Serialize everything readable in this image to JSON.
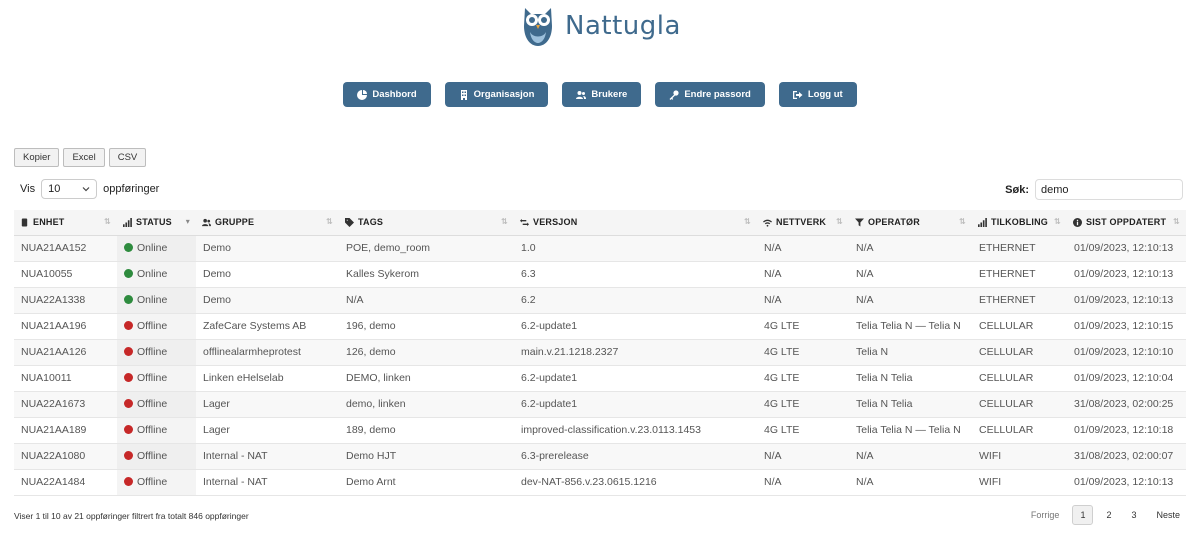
{
  "brand": {
    "name": "Nattugla"
  },
  "nav": [
    {
      "label": "Dashbord",
      "icon": "pie-chart-icon"
    },
    {
      "label": "Organisasjon",
      "icon": "building-icon"
    },
    {
      "label": "Brukere",
      "icon": "users-icon"
    },
    {
      "label": "Endre passord",
      "icon": "key-icon"
    },
    {
      "label": "Logg ut",
      "icon": "logout-icon"
    }
  ],
  "export": {
    "copy": "Kopier",
    "excel": "Excel",
    "csv": "CSV"
  },
  "length": {
    "prefix": "Vis",
    "value": "10",
    "suffix": "oppføringer"
  },
  "search": {
    "label": "Søk:",
    "value": "demo"
  },
  "columns": [
    {
      "label": "ENHET",
      "icon": "device-icon"
    },
    {
      "label": "STATUS",
      "icon": "signal-bars-icon"
    },
    {
      "label": "GRUPPE",
      "icon": "users-icon"
    },
    {
      "label": "TAGS",
      "icon": "tag-icon"
    },
    {
      "label": "VERSJON",
      "icon": "code-branch-icon"
    },
    {
      "label": "NETTVERK",
      "icon": "wifi-icon"
    },
    {
      "label": "OPERATØR",
      "icon": "filter-icon"
    },
    {
      "label": "TILKOBLING",
      "icon": "signal-bars-icon"
    },
    {
      "label": "SIST OPPDATERT",
      "icon": "info-circle-icon"
    }
  ],
  "status_colors": {
    "Online": "#2e8b3e",
    "Offline": "#c62828"
  },
  "rows": [
    [
      "NUA21AA152",
      "Online",
      "Demo",
      "POE, demo_room",
      "1.0",
      "N/A",
      "N/A",
      "ETHERNET",
      "01/09/2023, 12:10:13"
    ],
    [
      "NUA10055",
      "Online",
      "Demo",
      "Kalles Sykerom",
      "6.3",
      "N/A",
      "N/A",
      "ETHERNET",
      "01/09/2023, 12:10:13"
    ],
    [
      "NUA22A1338",
      "Online",
      "Demo",
      "N/A",
      "6.2",
      "N/A",
      "N/A",
      "ETHERNET",
      "01/09/2023, 12:10:13"
    ],
    [
      "NUA21AA196",
      "Offline",
      "ZafeCare Systems AB",
      "196, demo",
      "6.2-update1",
      "4G LTE",
      "Telia Telia N — Telia N",
      "CELLULAR",
      "01/09/2023, 12:10:15"
    ],
    [
      "NUA21AA126",
      "Offline",
      "offlinealarmheprotest",
      "126, demo",
      "main.v.21.1218.2327",
      "4G LTE",
      "Telia N",
      "CELLULAR",
      "01/09/2023, 12:10:10"
    ],
    [
      "NUA10011",
      "Offline",
      "Linken eHelselab",
      "DEMO, linken",
      "6.2-update1",
      "4G LTE",
      "Telia N Telia",
      "CELLULAR",
      "01/09/2023, 12:10:04"
    ],
    [
      "NUA22A1673",
      "Offline",
      "Lager",
      "demo, linken",
      "6.2-update1",
      "4G LTE",
      "Telia N Telia",
      "CELLULAR",
      "31/08/2023, 02:00:25"
    ],
    [
      "NUA21AA189",
      "Offline",
      "Lager",
      "189, demo",
      "improved-classification.v.23.0113.1453",
      "4G LTE",
      "Telia Telia N — Telia N",
      "CELLULAR",
      "01/09/2023, 12:10:18"
    ],
    [
      "NUA22A1080",
      "Offline",
      "Internal - NAT",
      "Demo HJT",
      "6.3-prerelease",
      "N/A",
      "N/A",
      "WIFI",
      "31/08/2023, 02:00:07"
    ],
    [
      "NUA22A1484",
      "Offline",
      "Internal - NAT",
      "Demo Arnt",
      "dev-NAT-856.v.23.0615.1216",
      "N/A",
      "N/A",
      "WIFI",
      "01/09/2023, 12:10:13"
    ]
  ],
  "info": "Viser 1 til 10 av 21 oppføringer filtrert fra totalt 846 oppføringer",
  "pagination": {
    "prev": "Forrige",
    "pages": [
      "1",
      "2",
      "3"
    ],
    "current": "1",
    "next": "Neste"
  }
}
